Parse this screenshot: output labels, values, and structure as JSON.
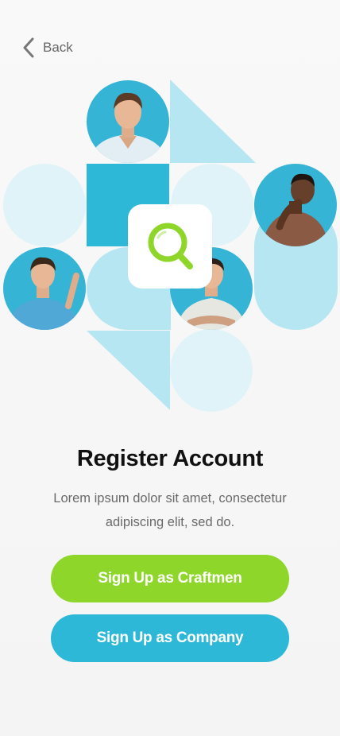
{
  "nav": {
    "back_label": "Back",
    "back_icon": "chevron-left-icon"
  },
  "hero": {
    "center_icon": "search-icon",
    "people": [
      {
        "name": "person-top-avatar"
      },
      {
        "name": "person-right-avatar"
      },
      {
        "name": "person-left-avatar"
      },
      {
        "name": "person-center-avatar"
      }
    ]
  },
  "content": {
    "title": "Register Account",
    "description": "Lorem ipsum dolor sit amet, consectetur adipiscing elit, sed do."
  },
  "actions": {
    "craftmen_label": "Sign Up as Craftmen",
    "company_label": "Sign Up as Company"
  },
  "colors": {
    "accent_green": "#8ed72a",
    "accent_blue": "#2db8d8",
    "shape_light": "#b5e6f2",
    "shape_pale": "#e0f3f8",
    "shape_dark": "#2db8d8",
    "title_text": "#111111",
    "body_text": "#6a6a6a"
  }
}
